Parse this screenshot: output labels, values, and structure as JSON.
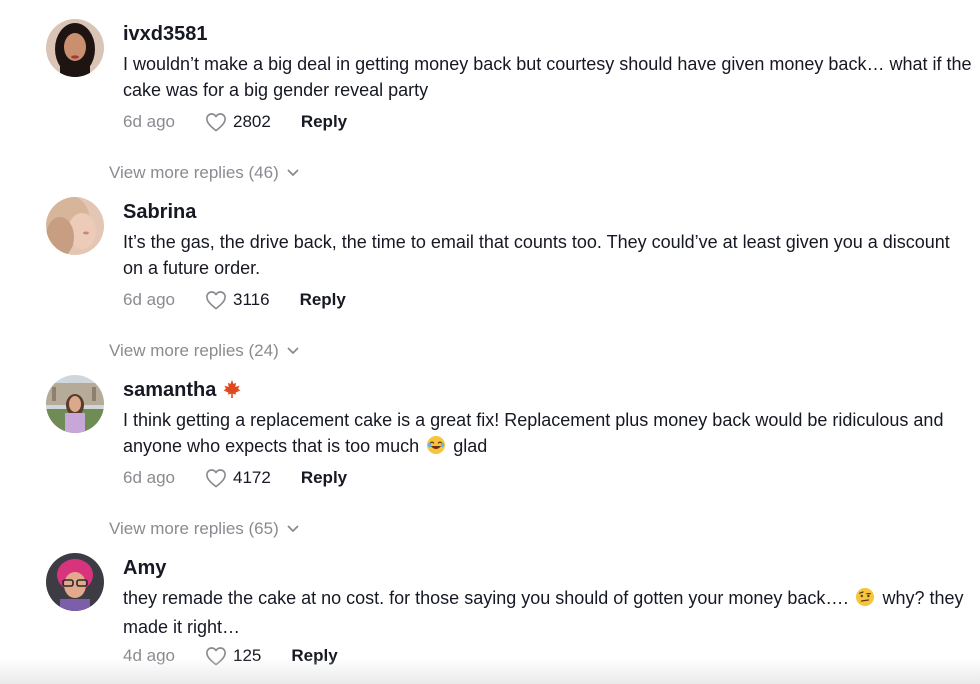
{
  "comments": [
    {
      "username": "ivxd3581",
      "text": "I wouldn’t make a big deal in getting money back but courtesy should have given money back… what if the cake was for a big gender reveal party",
      "time": "6d ago",
      "likes": "2802",
      "reply_label": "Reply",
      "view_more": "View more replies (46)"
    },
    {
      "username": "Sabrina",
      "text": "It’s the gas, the drive back, the time to email that counts too. They could’ve at least given you a discount on a future order.",
      "time": "6d ago",
      "likes": "3116",
      "reply_label": "Reply",
      "view_more": "View more replies (24)"
    },
    {
      "username": "samantha",
      "name_emoji": "maple-leaf",
      "text_before": "I think getting a replacement cake is a great fix! Replacement plus money back would be ridiculous and anyone who expects that is too much",
      "text_emoji": "laughing-crying-face",
      "text_after": "glad",
      "time": "6d ago",
      "likes": "4172",
      "reply_label": "Reply",
      "view_more": "View more replies (65)"
    },
    {
      "username": "Amy",
      "text_before": "they remade the cake at no cost. for those saying you should of gotten your money back….",
      "text_emoji": "raised-eyebrow-face",
      "text_after": "why? they made it right…",
      "time": "4d ago",
      "likes": "125",
      "reply_label": "Reply"
    }
  ],
  "colors": {
    "text": "#161823",
    "muted": "#8a8b91",
    "background": "#ffffff"
  }
}
